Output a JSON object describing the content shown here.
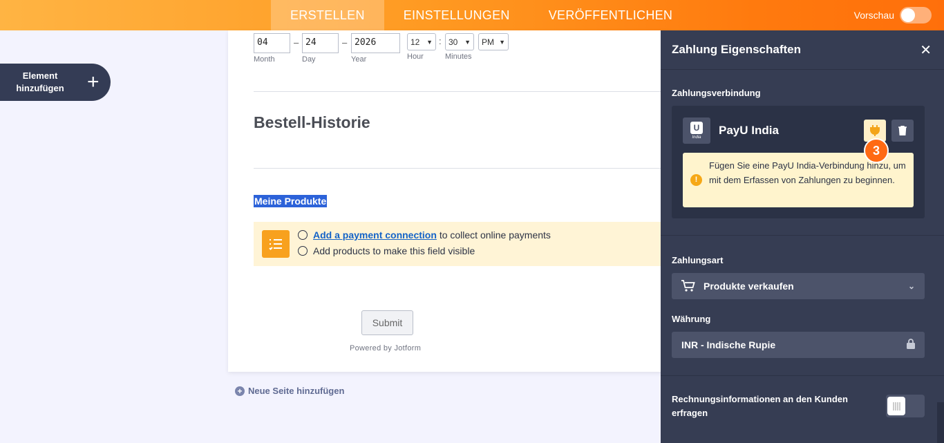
{
  "topbar": {
    "tabs": [
      "ERSTELLEN",
      "EINSTELLUNGEN",
      "VERÖFFENTLICHEN"
    ],
    "preview_label": "Vorschau",
    "preview_on": false
  },
  "sidebar": {
    "add_element_label": "Element hinzufügen",
    "plus": "+"
  },
  "form": {
    "date": {
      "month": "04",
      "day": "24",
      "year": "2026",
      "month_label": "Month",
      "day_label": "Day",
      "year_label": "Year",
      "dash": "–"
    },
    "time": {
      "hour": "12",
      "minutes": "30",
      "ampm": "PM",
      "hour_label": "Hour",
      "minutes_label": "Minutes",
      "colon": ":"
    },
    "section_title": "Bestell-Historie",
    "products_label": "Meine Produkte",
    "notice": {
      "link_text": "Add a payment connection",
      "line1_rest": "to collect online payments",
      "line2": "Add products to make this field visible"
    },
    "submit_label": "Submit",
    "powered_by": "Powered by Jotform"
  },
  "add_page_label": "Neue Seite hinzufügen",
  "panel": {
    "title": "Zahlung Eigenschaften",
    "close": "✕",
    "connection_section": "Zahlungsverbindung",
    "gateway_name": "PayU India",
    "gateway_logo_text": "India",
    "step_badge": "3",
    "warning": "Fügen Sie eine PayU India-Verbindung hinzu, um mit dem Erfassen von Zahlungen zu beginnen.",
    "payment_type_label": "Zahlungsart",
    "payment_type_value": "Produkte verkaufen",
    "currency_label": "Währung",
    "currency_value": "INR - Indische Rupie",
    "billing_label": "Rechnungsinformationen an den Kunden erfragen"
  },
  "colors": {
    "accent_orange": "#ff7a0e",
    "panel_bg": "#363d53",
    "notice_bg": "#fff4d6"
  }
}
